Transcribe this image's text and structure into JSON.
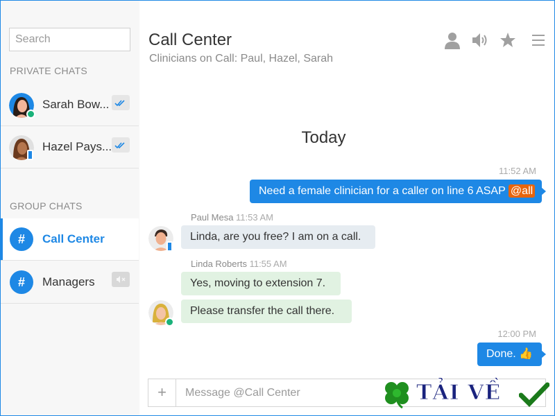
{
  "sidebar": {
    "search_placeholder": "Search",
    "private_label": "PRIVATE CHATS",
    "group_label": "GROUP CHATS",
    "private_chats": [
      {
        "name": "Sarah Bow..."
      },
      {
        "name": "Hazel Pays..."
      }
    ],
    "group_chats": [
      {
        "name": "Call Center",
        "icon": "#"
      },
      {
        "name": "Managers",
        "icon": "#"
      }
    ]
  },
  "header": {
    "title": "Call Center",
    "subtitle": "Clinicians on Call: Paul, Hazel, Sarah"
  },
  "conversation": {
    "day_label": "Today",
    "messages": [
      {
        "time": "11:52 AM",
        "text": "Need a female clinician for a caller on line 6 ASAP",
        "mention": "@all"
      },
      {
        "author": "Paul Mesa",
        "time": "11:53 AM",
        "text": "Linda, are you free? I am on a call."
      },
      {
        "author": "Linda Roberts",
        "time": "11:55 AM",
        "text": "Yes, moving to extension 7."
      },
      {
        "text": "Please transfer the call there."
      },
      {
        "time": "12:00 PM",
        "text": "Done. 👍"
      }
    ]
  },
  "composer": {
    "plus_label": "+",
    "placeholder": "Message @Call Center"
  },
  "watermark": {
    "text": "TẢI VỀ"
  },
  "colors": {
    "accent": "#1e88e5",
    "mention": "#e8650c",
    "online": "#1ab27a"
  }
}
